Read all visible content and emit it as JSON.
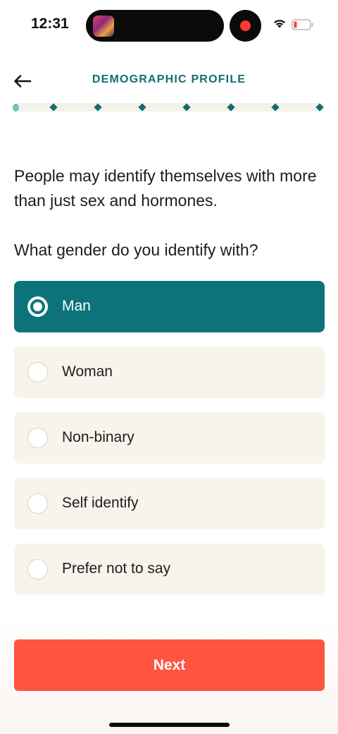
{
  "status_bar": {
    "time": "12:31",
    "icons": [
      "app-thumbnail-icon",
      "screen-record-icon",
      "wifi-icon",
      "battery-low-icon"
    ],
    "record_color": "#ff3b30",
    "battery_color": "#ff3b30"
  },
  "header": {
    "back_icon": "arrow-left-icon",
    "title": "DEMOGRAPHIC PROFILE"
  },
  "progress": {
    "steps_total": 8,
    "current_step": 1,
    "accent": "#0f6e74"
  },
  "question": {
    "intro": "People may identify themselves with more than just sex and hormones.",
    "prompt": "What gender do you identify with?"
  },
  "options": [
    {
      "label": "Man",
      "selected": true
    },
    {
      "label": "Woman",
      "selected": false
    },
    {
      "label": "Non-binary",
      "selected": false
    },
    {
      "label": "Self identify",
      "selected": false
    },
    {
      "label": "Prefer not to say",
      "selected": false
    }
  ],
  "actions": {
    "next_label": "Next",
    "next_color": "#fe5440"
  },
  "colors": {
    "selected_bg": "#0c737a",
    "option_bg": "#f7f4ec"
  }
}
